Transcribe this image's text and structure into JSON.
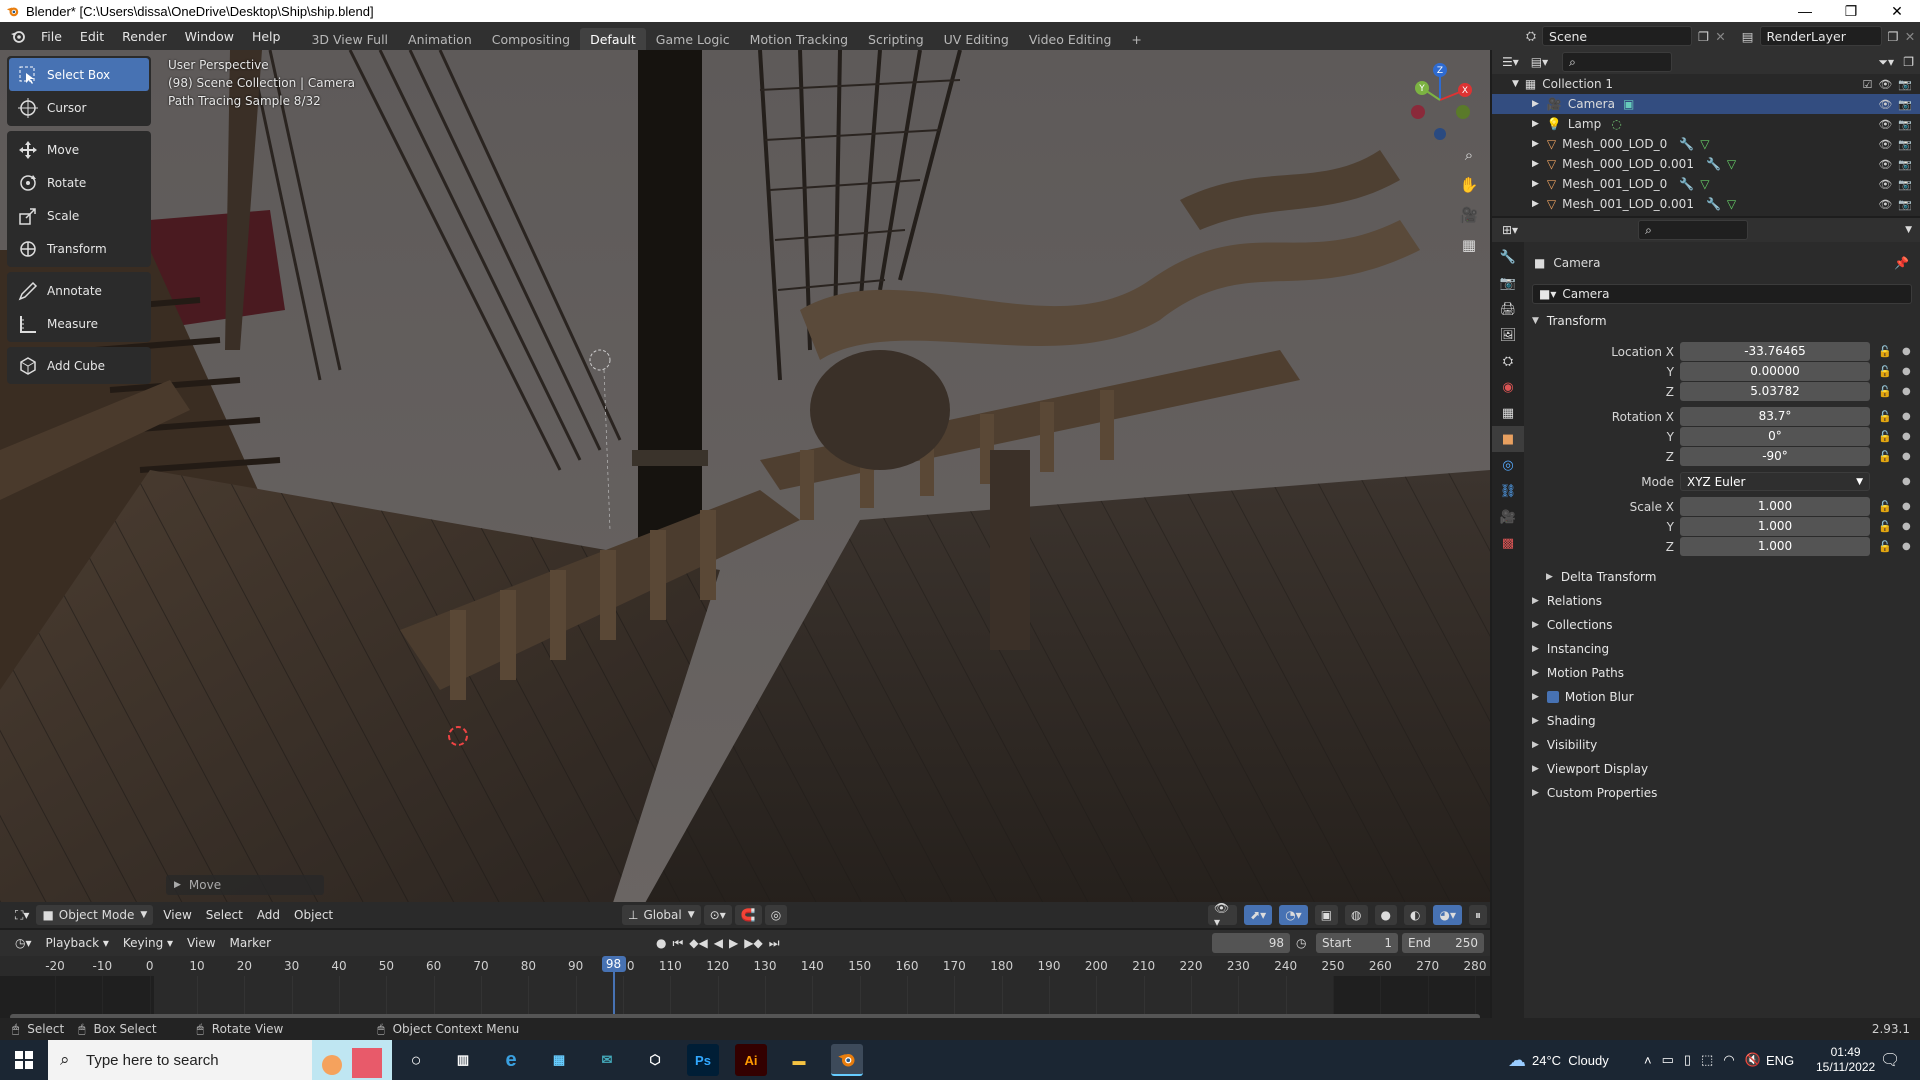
{
  "window": {
    "title": "Blender* [C:\\Users\\dissa\\OneDrive\\Desktop\\Ship\\ship.blend]",
    "minimize": "—",
    "maximize": "❐",
    "close": "✕"
  },
  "menu": {
    "items": [
      "File",
      "Edit",
      "Render",
      "Window",
      "Help"
    ],
    "workspaces": [
      "3D View Full",
      "Animation",
      "Compositing",
      "Default",
      "Game Logic",
      "Motion Tracking",
      "Scripting",
      "UV Editing",
      "Video Editing"
    ],
    "active_workspace": "Default",
    "add_tab": "+",
    "scene": "Scene",
    "render_layer": "RenderLayer"
  },
  "viewport": {
    "info_line1": "User Perspective",
    "info_line2": "(98) Scene Collection | Camera",
    "info_line3": "Path Tracing Sample 8/32",
    "move_panel": "Move",
    "gizmo": {
      "x": "X",
      "y": "Y",
      "z": "Z"
    }
  },
  "toolbar": {
    "groups": [
      [
        "Select Box",
        "Cursor"
      ],
      [
        "Move",
        "Rotate",
        "Scale",
        "Transform"
      ],
      [
        "Annotate",
        "Measure"
      ],
      [
        "Add Cube"
      ]
    ],
    "active": "Select Box"
  },
  "viewport_header": {
    "mode": "Object Mode",
    "menus": [
      "View",
      "Select",
      "Add",
      "Object"
    ],
    "orientation": "Global"
  },
  "timeline_header": {
    "menus": [
      "Playback",
      "Keying",
      "View",
      "Marker"
    ],
    "current_frame": "98",
    "start_label": "Start",
    "start": "1",
    "end_label": "End",
    "end": "250"
  },
  "timeline": {
    "ticks": [
      "-20",
      "-10",
      "0",
      "10",
      "20",
      "30",
      "40",
      "50",
      "60",
      "70",
      "80",
      "90",
      "100",
      "110",
      "120",
      "130",
      "140",
      "150",
      "160",
      "170",
      "180",
      "190",
      "200",
      "210",
      "220",
      "230",
      "240",
      "250",
      "260",
      "270",
      "280"
    ],
    "playhead": "98"
  },
  "statusbar": {
    "select": "Select",
    "box_select": "Box Select",
    "rotate_view": "Rotate View",
    "context_menu": "Object Context Menu",
    "version": "2.93.1"
  },
  "outliner": {
    "collection": "Collection 1",
    "items": [
      "Camera",
      "Lamp",
      "Mesh_000_LOD_0",
      "Mesh_000_LOD_0.001",
      "Mesh_001_LOD_0",
      "Mesh_001_LOD_0.001"
    ],
    "selected": "Camera"
  },
  "properties": {
    "object_name": "Camera",
    "data_name": "Camera",
    "transform_title": "Transform",
    "location_label": "Location X",
    "rotation_label": "Rotation X",
    "scale_label": "Scale X",
    "y_label": "Y",
    "z_label": "Z",
    "location": [
      "-33.76465",
      "0.00000",
      "5.03782"
    ],
    "rotation": [
      "83.7°",
      "0°",
      "-90°"
    ],
    "mode_label": "Mode",
    "mode": "XYZ Euler",
    "scale": [
      "1.000",
      "1.000",
      "1.000"
    ],
    "delta_transform": "Delta Transform",
    "panels": [
      "Relations",
      "Collections",
      "Instancing",
      "Motion Paths",
      "Motion Blur",
      "Shading",
      "Visibility",
      "Viewport Display",
      "Custom Properties"
    ]
  },
  "taskbar": {
    "search_placeholder": "Type here to search",
    "weather": "24°C  Cloudy",
    "language": "ENG",
    "time": "01:49",
    "date": "15/11/2022",
    "apps": {
      "ps": "Ps",
      "ai": "Ai"
    }
  },
  "colors": {
    "accent": "#4772b3",
    "selection": "#334d80",
    "panel": "#2b2b2b",
    "taskbar": "#1b2633"
  }
}
